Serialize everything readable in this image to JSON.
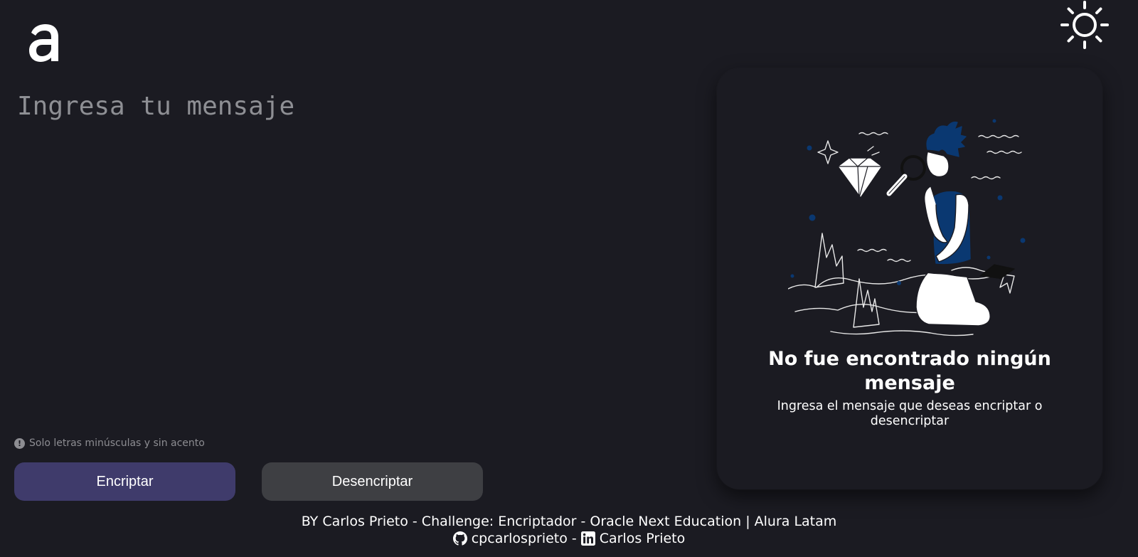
{
  "header": {
    "logo_icon": "alura-logo-icon",
    "theme_toggle_icon": "sun-icon"
  },
  "input": {
    "placeholder": "Ingresa tu mensaje",
    "value": ""
  },
  "hint": {
    "icon": "exclamation-circle-icon",
    "text": "Solo letras minúsculas y sin acento"
  },
  "buttons": {
    "encrypt_label": "Encriptar",
    "decrypt_label": "Desencriptar"
  },
  "result": {
    "illustration": "person-with-magnifying-glass-illustration",
    "title_line1": "No fue encontrado ningún",
    "title_line2": "mensaje",
    "subtitle": "Ingresa el mensaje que deseas encriptar o desencriptar"
  },
  "footer": {
    "credits": "BY Carlos Prieto - Challenge: Encriptador - Oracle Next Education | Alura Latam",
    "github_icon": "github-icon",
    "github_user": "cpcarlosprieto",
    "separator": "-",
    "linkedin_icon": "linkedin-icon",
    "linkedin_name": "Carlos Prieto"
  },
  "colors": {
    "background": "#1b1b22",
    "encrypt_button": "#3f3b6b",
    "decrypt_button": "#3e3f43",
    "accent_blue": "#0a3871"
  }
}
